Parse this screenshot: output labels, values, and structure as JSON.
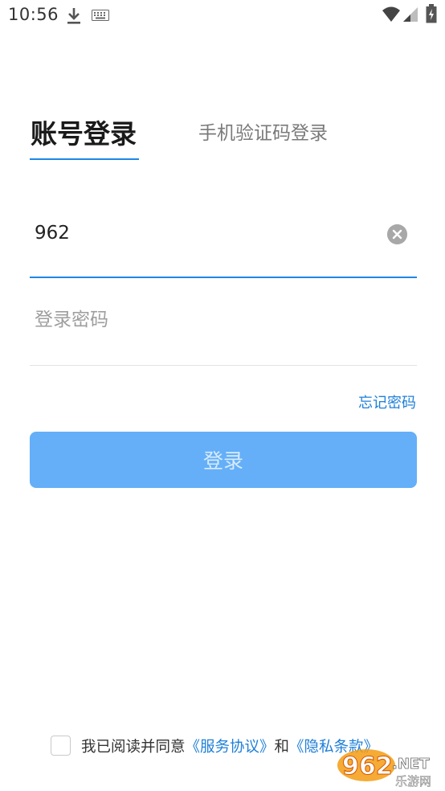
{
  "status_bar": {
    "time": "10:56",
    "icons": [
      "download-icon",
      "keyboard-icon",
      "wifi-icon",
      "signal-icon",
      "battery-icon"
    ]
  },
  "tabs": {
    "account_login": "账号登录",
    "sms_login": "手机验证码登录",
    "active": "account_login"
  },
  "form": {
    "account_value": "962",
    "password_placeholder": "登录密码",
    "forgot_password": "忘记密码",
    "login_button": "登录"
  },
  "agreement": {
    "checked": false,
    "prefix": "我已阅读并同意",
    "service_link": "《服务协议》",
    "conjunction": "和",
    "privacy_link": "《隐私条款》"
  },
  "watermark": {
    "brand": "962",
    "suffix": ".NET",
    "tagline": "乐游网"
  },
  "colors": {
    "accent": "#1e88e5",
    "link": "#1e7fd8",
    "button": "#64aff8",
    "button_text": "#d8ebfd"
  }
}
